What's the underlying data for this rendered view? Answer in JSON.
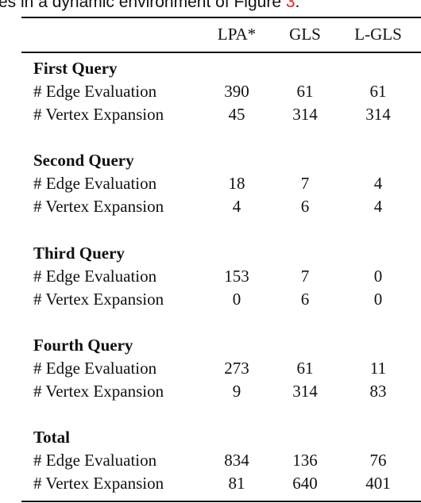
{
  "caption": {
    "text_before": "es in a dynamic environment of Figure ",
    "ref": "3",
    "text_after": "."
  },
  "table": {
    "columns": [
      "LPA*",
      "GLS",
      "L-GLS"
    ],
    "sections": [
      {
        "title": "First Query",
        "rows": [
          {
            "label": "# Edge Evaluation",
            "values": [
              "390",
              "61",
              "61"
            ]
          },
          {
            "label": "# Vertex Expansion",
            "values": [
              "45",
              "314",
              "314"
            ]
          }
        ]
      },
      {
        "title": "Second Query",
        "rows": [
          {
            "label": "# Edge Evaluation",
            "values": [
              "18",
              "7",
              "4"
            ]
          },
          {
            "label": "# Vertex Expansion",
            "values": [
              "4",
              "6",
              "4"
            ]
          }
        ]
      },
      {
        "title": "Third Query",
        "rows": [
          {
            "label": "# Edge Evaluation",
            "values": [
              "153",
              "7",
              "0"
            ]
          },
          {
            "label": "# Vertex Expansion",
            "values": [
              "0",
              "6",
              "0"
            ]
          }
        ]
      },
      {
        "title": "Fourth Query",
        "rows": [
          {
            "label": "# Edge Evaluation",
            "values": [
              "273",
              "61",
              "11"
            ]
          },
          {
            "label": "# Vertex Expansion",
            "values": [
              "9",
              "314",
              "83"
            ]
          }
        ]
      },
      {
        "title": "Total",
        "rows": [
          {
            "label": "# Edge Evaluation",
            "values": [
              "834",
              "136",
              "76"
            ]
          },
          {
            "label": "# Vertex Expansion",
            "values": [
              "81",
              "640",
              "401"
            ]
          }
        ]
      }
    ]
  },
  "colors": {
    "text": "#111111",
    "reference_link": "#e8191c"
  }
}
